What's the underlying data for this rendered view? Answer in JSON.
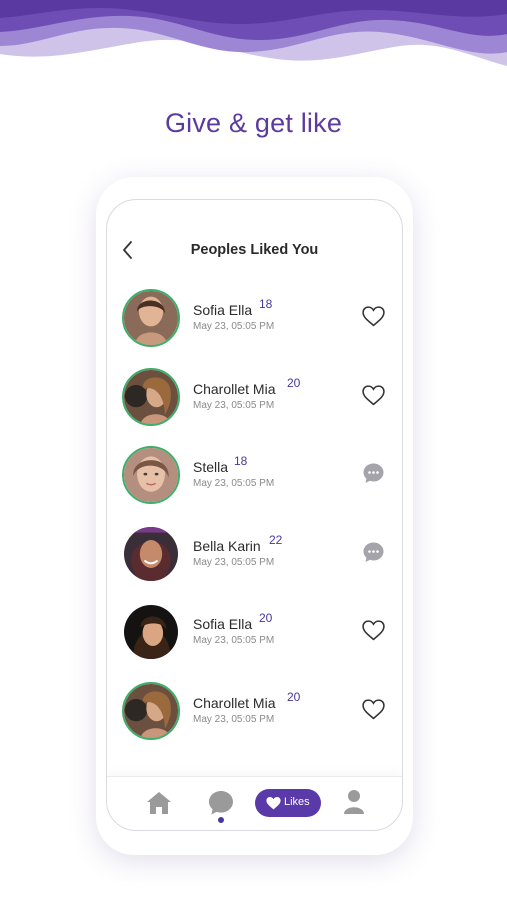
{
  "headline": "Give & get like",
  "screen": {
    "title": "Peoples Liked You",
    "back_icon": "chevron-left-icon"
  },
  "colors": {
    "brand_purple": "#5a3aa8",
    "headline_purple": "#5c3a9e",
    "avatar_ring": "#3fae6a",
    "icon_gray": "#9a9a9a"
  },
  "people": [
    {
      "name": "Sofia Ella",
      "age": "18",
      "time": "May 23, 05:05 PM",
      "action_icon": "heart-outline-icon"
    },
    {
      "name": "Charollet Mia",
      "age": "20",
      "time": "May 23, 05:05 PM",
      "action_icon": "heart-outline-icon"
    },
    {
      "name": "Stella",
      "age": "18",
      "time": "May 23, 05:05 PM",
      "action_icon": "chat-bubble-icon"
    },
    {
      "name": "Bella Karin",
      "age": "22",
      "time": "May 23, 05:05 PM",
      "action_icon": "chat-bubble-icon"
    },
    {
      "name": "Sofia Ella",
      "age": "20",
      "time": "May 23, 05:05 PM",
      "action_icon": "heart-outline-icon"
    },
    {
      "name": "Charollet Mia",
      "age": "20",
      "time": "May 23, 05:05 PM",
      "action_icon": "heart-outline-icon"
    }
  ],
  "nav": {
    "home_icon": "home-icon",
    "chat_icon": "chat-bubble-icon",
    "likes_label": "Likes",
    "profile_icon": "user-icon"
  }
}
